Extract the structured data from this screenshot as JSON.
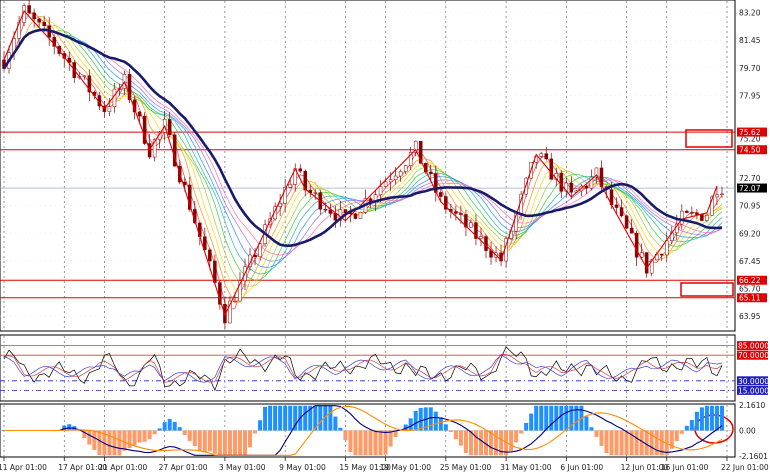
{
  "colors": {
    "background": "#ffffff",
    "candle": "#8b0000",
    "zigzag": "#e00000",
    "moving_average": "#1a1a6b",
    "level_line": "#e00000",
    "price_marker_bg": "#000000",
    "level_marker_bg": "#e00000",
    "rsi_fast": "#000000",
    "rsi_mid": "#d04040",
    "rsi_slow": "#4040d0",
    "rsi_threshold": "#2020c0",
    "macd_positive": "#1e90ff",
    "macd_negative": "#ff9966",
    "macd_line": "#00007f",
    "signal_line": "#ff8c00",
    "grid": "#555555"
  },
  "icons": [
    "red-rectangle-annotation",
    "red-circle-annotation"
  ],
  "chart_data": [
    {
      "type": "candlestick",
      "panel": "price",
      "ylim": [
        63.0,
        84.0
      ],
      "y_ticks": [
        "83.20",
        "81.45",
        "79.70",
        "77.95",
        "75.20",
        "72.70",
        "70.95",
        "69.20",
        "67.45",
        "63.95"
      ],
      "y_tick_values": [
        83.2,
        81.45,
        79.7,
        77.95,
        75.2,
        72.7,
        70.95,
        69.2,
        67.45,
        63.95
      ],
      "current_price": "72.07",
      "current_price_value": 72.07,
      "levels": [
        {
          "label": "75.62",
          "value": 75.62
        },
        {
          "label": "74.50",
          "value": 74.5
        },
        {
          "label": "66.22",
          "value": 66.22
        },
        {
          "label": "65.70",
          "value": 65.7
        },
        {
          "label": "65.11",
          "value": 65.11
        }
      ],
      "level_lines": [
        75.62,
        74.5,
        66.22,
        65.11
      ],
      "zigzag": [
        {
          "d": 0,
          "p": 80.2
        },
        {
          "d": 2,
          "p": 83.3
        },
        {
          "d": 5,
          "p": 81.2
        },
        {
          "d": 10,
          "p": 77.1
        },
        {
          "d": 12,
          "p": 78.8
        },
        {
          "d": 14.5,
          "p": 74.5
        },
        {
          "d": 16,
          "p": 76.0
        },
        {
          "d": 22,
          "p": 64.0
        },
        {
          "d": 29,
          "p": 73.3
        },
        {
          "d": 30,
          "p": 72.0
        },
        {
          "d": 34,
          "p": 70.0
        },
        {
          "d": 41,
          "p": 74.5
        },
        {
          "d": 43.5,
          "p": 71.2
        },
        {
          "d": 49.5,
          "p": 67.5
        },
        {
          "d": 53,
          "p": 74.2
        },
        {
          "d": 56.5,
          "p": 71.5
        },
        {
          "d": 59,
          "p": 72.9
        },
        {
          "d": 60.5,
          "p": 71.0
        },
        {
          "d": 64,
          "p": 67.0
        },
        {
          "d": 67.5,
          "p": 70.1
        },
        {
          "d": 70,
          "p": 70.5
        },
        {
          "d": 71,
          "p": 72.2
        }
      ],
      "candles_per_day": 2,
      "days": 72
    },
    {
      "type": "line",
      "panel": "rsi",
      "ylim": [
        0,
        100
      ],
      "y_ticks": [
        "85.0000",
        "70.0000",
        "30.0000",
        "15.0000"
      ],
      "y_tick_values": [
        85,
        70,
        30,
        15
      ],
      "series_count": 3
    },
    {
      "type": "bar",
      "panel": "macd",
      "ylim": [
        -2.1601,
        2.161
      ],
      "y_ticks": [
        "2.1610",
        "0.00",
        "-2.1601"
      ],
      "y_tick_values": [
        2.161,
        0.0,
        -2.1601
      ]
    }
  ],
  "x_axis": {
    "start_day": 0,
    "end_day": 72,
    "ticks": [
      {
        "label": "11 Apr 01:00",
        "day": 0
      },
      {
        "label": "17 Apr 01:00",
        "day": 6
      },
      {
        "label": "21 Apr 01:00",
        "day": 10
      },
      {
        "label": "27 Apr 01:00",
        "day": 16
      },
      {
        "label": "3 May 01:00",
        "day": 22
      },
      {
        "label": "9 May 01:00",
        "day": 28
      },
      {
        "label": "15 May 01:00",
        "day": 34
      },
      {
        "label": "19 May 01:00",
        "day": 38
      },
      {
        "label": "25 May 01:00",
        "day": 44
      },
      {
        "label": "31 May 01:00",
        "day": 50
      },
      {
        "label": "6 Jun 01:00",
        "day": 56
      },
      {
        "label": "12 Jun 01:00",
        "day": 62
      },
      {
        "label": "16 Jun 01:00",
        "day": 66
      },
      {
        "label": "22 Jun 01:00",
        "day": 72
      }
    ]
  }
}
